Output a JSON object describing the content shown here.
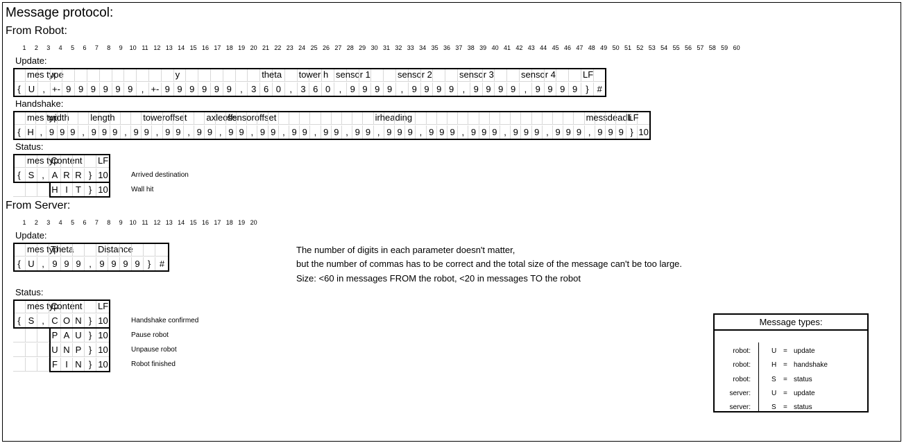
{
  "title": "Message protocol:",
  "from_robot": {
    "heading": "From Robot:",
    "column_numbers": [
      "1",
      "2",
      "3",
      "4",
      "5",
      "6",
      "7",
      "8",
      "9",
      "10",
      "11",
      "12",
      "13",
      "14",
      "15",
      "16",
      "17",
      "18",
      "19",
      "20",
      "21",
      "22",
      "23",
      "24",
      "25",
      "26",
      "27",
      "28",
      "29",
      "30",
      "31",
      "32",
      "33",
      "34",
      "35",
      "36",
      "37",
      "38",
      "39",
      "40",
      "41",
      "42",
      "43",
      "44",
      "45",
      "46",
      "47",
      "48",
      "49",
      "50",
      "51",
      "52",
      "53",
      "54",
      "55",
      "56",
      "57",
      "58",
      "59",
      "60"
    ],
    "update": {
      "label": "Update:",
      "header": [
        "",
        "mes type",
        "",
        "x",
        "",
        "",
        "",
        "",
        "",
        "",
        "",
        "",
        "",
        "y",
        "",
        "",
        "",
        "",
        "",
        "",
        "theta",
        "",
        "",
        "tower h",
        "",
        "",
        "sensor 1",
        "",
        "",
        "",
        "",
        "sensor 2",
        "",
        "",
        "",
        "",
        "sensor 3",
        "",
        "",
        "",
        "",
        "sensor 4",
        "",
        "",
        "",
        "",
        "LF"
      ],
      "values": [
        "{",
        "U",
        ",",
        "+-",
        "9",
        "9",
        "9",
        "9",
        "9",
        "9",
        ",",
        "+-",
        "9",
        "9",
        "9",
        "9",
        "9",
        "9",
        ",",
        "3",
        "6",
        "0",
        ",",
        "3",
        "6",
        "0",
        ",",
        "9",
        "9",
        "9",
        "9",
        ",",
        "9",
        "9",
        "9",
        "9",
        ",",
        "9",
        "9",
        "9",
        "9",
        ",",
        "9",
        "9",
        "9",
        "9",
        "}",
        "#"
      ]
    },
    "handshake": {
      "label": "Handshake:",
      "header": [
        "",
        "mes typ",
        "",
        "width",
        "",
        "",
        "",
        "length",
        "",
        "",
        "",
        "",
        "toweroffset",
        "",
        "",
        "",
        "",
        "",
        "axleoffs",
        "",
        "sensoroffset",
        "",
        "",
        "",
        "",
        "",
        "",
        "",
        "",
        "",
        "",
        "",
        "",
        "",
        "irheading",
        "",
        "",
        "",
        "",
        "",
        "",
        "",
        "",
        "",
        "",
        "",
        "",
        "",
        "",
        "",
        "",
        "",
        "",
        "",
        "messdeadli",
        "",
        "",
        "",
        "LF"
      ],
      "values": [
        "{",
        "H",
        ",",
        "9",
        "9",
        "9",
        ",",
        "9",
        "9",
        "9",
        ",",
        "9",
        "9",
        ",",
        "9",
        "9",
        ",",
        "9",
        "9",
        ",",
        "9",
        "9",
        ",",
        "9",
        "9",
        ",",
        "9",
        "9",
        ",",
        "9",
        "9",
        ",",
        "9",
        "9",
        ",",
        "9",
        "9",
        "9",
        ",",
        "9",
        "9",
        "9",
        ",",
        "9",
        "9",
        "9",
        ",",
        "9",
        "9",
        "9",
        ",",
        "9",
        "9",
        "9",
        ",",
        "9",
        "9",
        "9",
        "}",
        "10"
      ]
    },
    "status": {
      "label": "Status:",
      "header": [
        "",
        "mes typ",
        "",
        "Content",
        "",
        "",
        "",
        "LF"
      ],
      "rows": [
        {
          "values": [
            "{",
            "S",
            ",",
            "A",
            "R",
            "R",
            "}",
            "10"
          ],
          "description": "Arrived destination"
        },
        {
          "values": [
            "",
            "",
            "",
            "H",
            "I",
            "T",
            "}",
            "10"
          ],
          "description": "Wall hit"
        }
      ]
    }
  },
  "from_server": {
    "heading": "From Server:",
    "column_numbers": [
      "1",
      "2",
      "3",
      "4",
      "5",
      "6",
      "7",
      "8",
      "9",
      "10",
      "11",
      "12",
      "13",
      "14",
      "15",
      "16",
      "17",
      "18",
      "19",
      "20"
    ],
    "update": {
      "label": "Update:",
      "header": [
        "",
        "mes typ",
        "",
        "Theta",
        "",
        "",
        "",
        "Distance",
        "",
        "",
        "",
        "",
        "",
        "LF"
      ],
      "values": [
        "{",
        "U",
        ",",
        "9",
        "9",
        "9",
        ",",
        "9",
        "9",
        "9",
        "9",
        "}",
        "#"
      ]
    },
    "status": {
      "label": "Status:",
      "header": [
        "",
        "mes typ",
        "",
        "Content",
        "",
        "",
        "",
        "LF"
      ],
      "rows": [
        {
          "values": [
            "{",
            "S",
            ",",
            "C",
            "O",
            "N",
            "}",
            "10"
          ],
          "description": "Handshake confirmed"
        },
        {
          "values": [
            "",
            "",
            "",
            "P",
            "A",
            "U",
            "}",
            "10"
          ],
          "description": "Pause robot"
        },
        {
          "values": [
            "",
            "",
            "",
            "U",
            "N",
            "P",
            "}",
            "10"
          ],
          "description": "Unpause robot"
        },
        {
          "values": [
            "",
            "",
            "",
            "F",
            "I",
            "N",
            "}",
            "10"
          ],
          "description": "Robot finished"
        }
      ]
    }
  },
  "notes": [
    "The number of digits in each parameter doesn't matter,",
    "but the number of commas has to be correct and the total size of the message can't be too large.",
    "Size: <60 in messages FROM the robot, <20 in messages TO the robot"
  ],
  "legend": {
    "title": "Message types:",
    "rows": [
      {
        "source": "robot:",
        "code": "U",
        "eq": "=",
        "meaning": "update"
      },
      {
        "source": "robot:",
        "code": "H",
        "eq": "=",
        "meaning": "handshake"
      },
      {
        "source": "robot:",
        "code": "S",
        "eq": "=",
        "meaning": "status"
      },
      {
        "source": "server:",
        "code": "U",
        "eq": "=",
        "meaning": "update"
      },
      {
        "source": "server:",
        "code": "S",
        "eq": "=",
        "meaning": "status"
      }
    ]
  }
}
